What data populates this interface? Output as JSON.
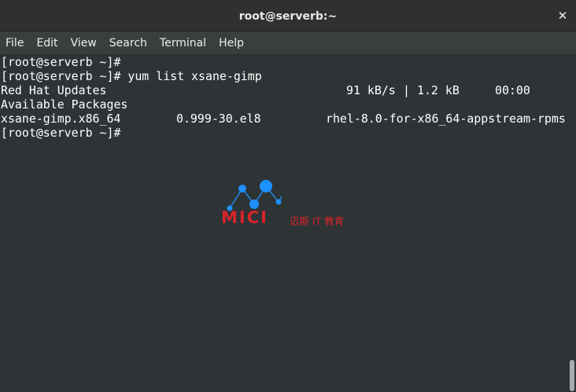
{
  "window": {
    "title": "root@serverb:~",
    "close_label": "✕"
  },
  "menubar": {
    "items": [
      "File",
      "Edit",
      "View",
      "Search",
      "Terminal",
      "Help"
    ]
  },
  "terminal": {
    "lines": [
      "[root@serverb ~]#",
      "[root@serverb ~]# yum list xsane-gimp",
      "Red Hat Updates",
      "Available Packages",
      "xsane-gimp.x86_64",
      "[root@serverb ~]#"
    ],
    "repo_progress": {
      "speed": "91 kB/s",
      "separator": "|",
      "size": "1.2 kB",
      "time": "00:00"
    },
    "package_row": {
      "name": "xsane-gimp.x86_64",
      "version": "0.999-30.el8",
      "repo": "rhel-8.0-for-x86_64-appstream-rpms"
    }
  },
  "watermark": {
    "logo_text": "MICI",
    "chinese_text": "迈斯 IT 教育",
    "colors": {
      "red": "#d8232a",
      "blue": "#1e90ff"
    }
  },
  "colors": {
    "titlebar": "#303030",
    "menubar": "#393f3f",
    "terminal_bg": "#2e3436",
    "terminal_fg": "#ffffff"
  }
}
